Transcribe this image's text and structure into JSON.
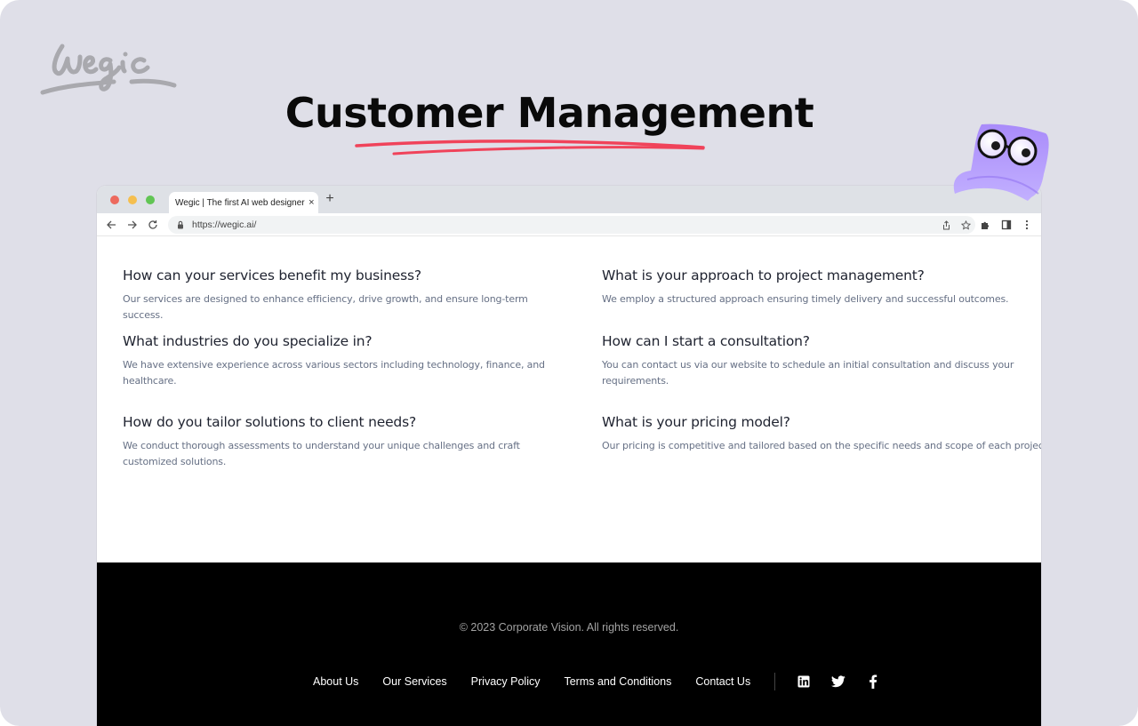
{
  "logo": {
    "text": "wegic"
  },
  "hero": {
    "title": "Customer Management",
    "underline_color": "#f0435a"
  },
  "mascot": {
    "name": "wegic-mascot",
    "color": "#a98bfa"
  },
  "browser": {
    "tab_title": "Wegic | The first AI web designer",
    "tab_close": "×",
    "new_tab": "+",
    "url": "https://wegic.ai/",
    "traffic_lights": {
      "close": "#ed6a5e",
      "minimize": "#f5bf4f",
      "maximize": "#61c554"
    }
  },
  "faq": {
    "items": [
      {
        "question": "How can your services benefit my business?",
        "answer": "Our services are designed to enhance efficiency, drive growth, and ensure long-term success."
      },
      {
        "question": "What is your approach to project management?",
        "answer": "We employ a structured approach ensuring timely delivery and successful outcomes."
      },
      {
        "question": "What industries do you specialize in?",
        "answer": "We have extensive experience across various sectors including technology, finance, and healthcare."
      },
      {
        "question": "How can I start a consultation?",
        "answer": "You can contact us via our website to schedule an initial consultation and discuss your requirements."
      },
      {
        "question": "How do you tailor solutions to client needs?",
        "answer": "We conduct thorough assessments to understand your unique challenges and craft customized solutions."
      },
      {
        "question": "What is your pricing model?",
        "answer": "Our pricing is competitive and tailored based on the specific needs and scope of each project."
      }
    ]
  },
  "footer": {
    "copyright": "© 2023 Corporate Vision. All rights reserved.",
    "links": [
      "About Us",
      "Our Services",
      "Privacy Policy",
      "Terms and Conditions",
      "Contact Us"
    ],
    "social": [
      "linkedin-icon",
      "twitter-icon",
      "facebook-icon"
    ]
  }
}
